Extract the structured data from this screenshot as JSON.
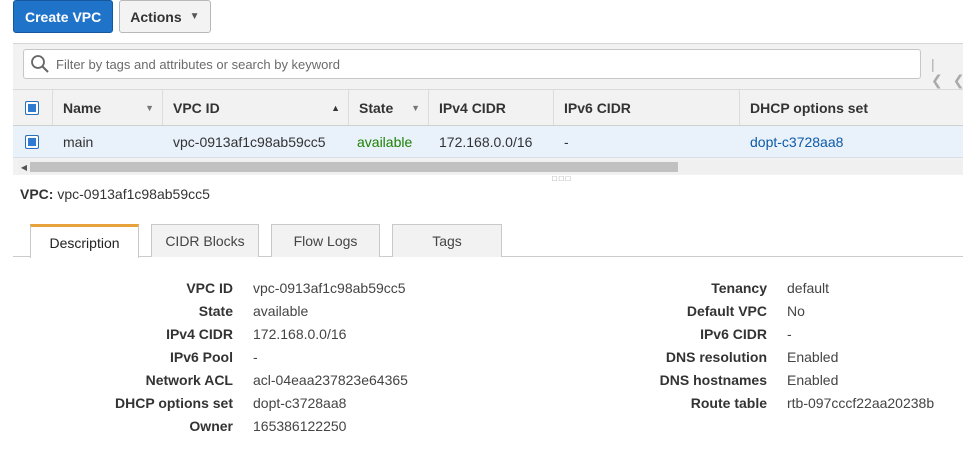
{
  "toolbar": {
    "create_label": "Create VPC",
    "actions_label": "Actions"
  },
  "filter": {
    "placeholder": "Filter by tags and attributes or search by keyword"
  },
  "table": {
    "columns": [
      "Name",
      "VPC ID",
      "State",
      "IPv4 CIDR",
      "IPv6 CIDR",
      "DHCP options set"
    ],
    "rows": [
      {
        "name": "main",
        "vpc_id": "vpc-0913af1c98ab59cc5",
        "state": "available",
        "ipv4": "172.168.0.0/16",
        "ipv6": "-",
        "dhcp": "dopt-c3728aa8"
      }
    ]
  },
  "selected": {
    "label": "VPC:",
    "value": "vpc-0913af1c98ab59cc5"
  },
  "tabs": [
    "Description",
    "CIDR Blocks",
    "Flow Logs",
    "Tags"
  ],
  "details_left": [
    {
      "label": "VPC ID",
      "value": "vpc-0913af1c98ab59cc5"
    },
    {
      "label": "State",
      "value": "available"
    },
    {
      "label": "IPv4 CIDR",
      "value": "172.168.0.0/16"
    },
    {
      "label": "IPv6 Pool",
      "value": "-"
    },
    {
      "label": "Network ACL",
      "value": "acl-04eaa237823e64365"
    },
    {
      "label": "DHCP options set",
      "value": "dopt-c3728aa8"
    },
    {
      "label": "Owner",
      "value": "165386122250"
    }
  ],
  "details_right": [
    {
      "label": "Tenancy",
      "value": "default"
    },
    {
      "label": "Default VPC",
      "value": "No"
    },
    {
      "label": "IPv6 CIDR",
      "value": "-"
    },
    {
      "label": "DNS resolution",
      "value": "Enabled"
    },
    {
      "label": "DNS hostnames",
      "value": "Enabled"
    },
    {
      "label": "Route table",
      "value": "rtb-097cccf22aa20238b"
    }
  ],
  "colors": {
    "primary": "#1f73c9",
    "available": "#1d8102",
    "link": "#0d5aa7",
    "active_tab": "#e8a33d"
  }
}
